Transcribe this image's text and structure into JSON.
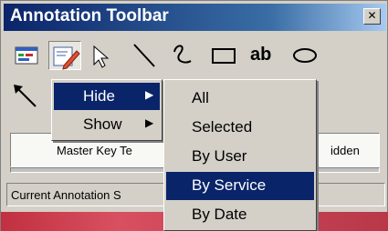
{
  "window": {
    "title": "Annotation Toolbar",
    "close_glyph": "✕"
  },
  "toolbar": {
    "tools": [
      {
        "icon": "annotation-manager-icon"
      },
      {
        "icon": "edit-annotation-icon"
      },
      {
        "icon": "select-pointer-icon"
      },
      {
        "icon": "line-icon"
      },
      {
        "icon": "freehand-icon"
      },
      {
        "icon": "rectangle-icon"
      },
      {
        "icon": "text-icon",
        "label": "ab"
      },
      {
        "icon": "ellipse-icon"
      }
    ],
    "second_row": [
      {
        "icon": "arrow-icon"
      }
    ]
  },
  "panel": {
    "left_text": "Master Key Te",
    "right_text": "idden"
  },
  "status_bar": {
    "text": "Current Annotation S"
  },
  "context_menu": {
    "items": [
      {
        "label": "Hide",
        "submenu_glyph": "▶",
        "selected": true
      },
      {
        "label": "Show",
        "submenu_glyph": "▶",
        "selected": false
      }
    ]
  },
  "submenu": {
    "items": [
      {
        "label": "All",
        "selected": false
      },
      {
        "label": "Selected",
        "selected": false
      },
      {
        "label": "By User",
        "selected": false
      },
      {
        "label": "By Service",
        "selected": true
      },
      {
        "label": "By Date",
        "selected": false
      }
    ]
  },
  "colors": {
    "selection": "#0a246a",
    "face": "#d4d0c8"
  }
}
